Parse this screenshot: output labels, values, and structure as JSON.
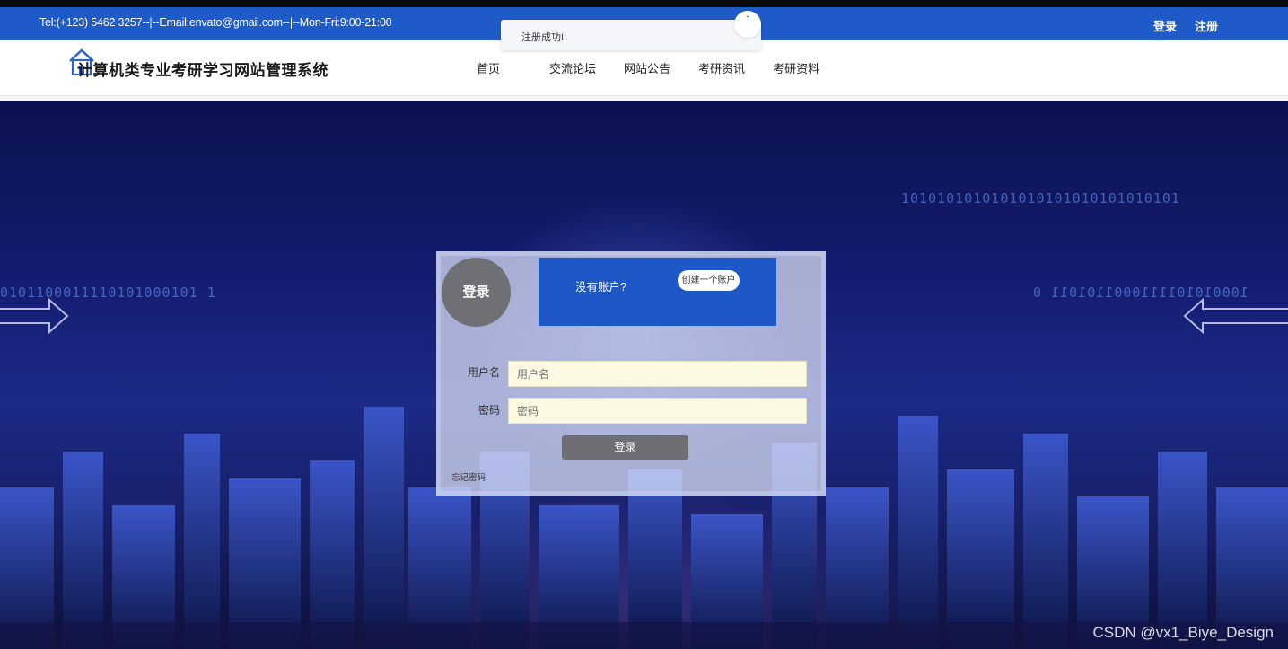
{
  "topbar": {
    "contact": "Tel:(+123) 5462 3257--|--Email:envato@gmail.com--|--Mon-Fri:9:00-21:00",
    "login": "登录",
    "register": "注册"
  },
  "toast": {
    "message": "注册成功!"
  },
  "header": {
    "title": "计算机类专业考研学习网站管理系统",
    "nav": [
      "首页",
      "交流论坛",
      "网站公告",
      "考研资讯",
      "考研资料"
    ]
  },
  "login_card": {
    "badge": "登录",
    "no_account": "没有账户?",
    "create_account": "创建一个账户",
    "username_label": "用户名",
    "username_placeholder": "用户名",
    "password_label": "密码",
    "password_placeholder": "密码",
    "submit": "登录",
    "forgot": "忘记密码"
  },
  "background": {
    "binary_left": "0101100011110101000101 1",
    "binary_top_right": "1010101010101010101010101010101",
    "binary_right": "1000101011110001101011 0",
    "watermark": "CSDN @vx1_Biye_Design"
  },
  "colors": {
    "brand_blue": "#1f5bc8",
    "badge_gray": "#6f6f76"
  }
}
